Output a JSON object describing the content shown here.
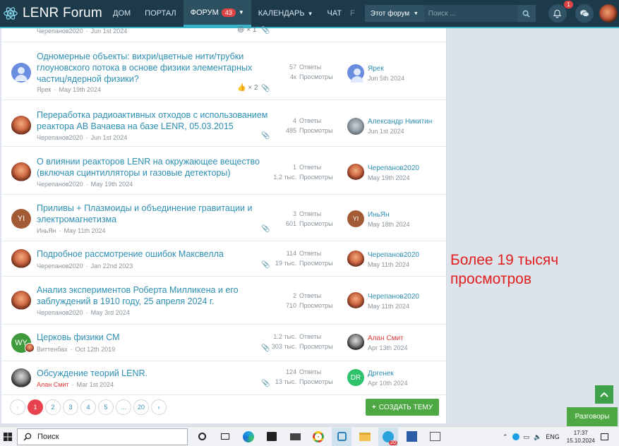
{
  "header": {
    "logo_text": "LENR Forum",
    "nav": [
      {
        "label": "ДОМ"
      },
      {
        "label": "ПОРТАЛ"
      },
      {
        "label": "ФОРУМ",
        "badge": "43",
        "active": true
      },
      {
        "label": "КАЛЕНДАРЬ"
      },
      {
        "label": "ЧАТ"
      }
    ],
    "nav_overflow": "F",
    "search_scope": "Этот форум",
    "search_placeholder": "Поиск ...",
    "alerts_badge": "1"
  },
  "threads": [
    {
      "title": "",
      "author": "Черепанов2020",
      "date": "Jun 1st 2024",
      "likes": "× 1",
      "partial": true
    },
    {
      "title": "Одномерные объекты: вихри/цветные нити/трубки глоуновского потока в основе физики элементарных частиц/ядерной физики?",
      "author": "Ярек",
      "date": "May 19th 2024",
      "likes": "× 2",
      "replies": "57",
      "views": "4к",
      "last_user": "Ярек",
      "last_date": "Jun 5th 2024"
    },
    {
      "title": "Переработка радиоактивных отходов с использованием реактора АВ Вачаева на базе LENR, 05.03.2015",
      "author": "Черепанов2020",
      "date": "Jun 1st 2024",
      "replies": "4",
      "views": "485",
      "last_user": "Александр Никитин",
      "last_date": "Jun 1st 2024"
    },
    {
      "title": "О влиянии реакторов LENR на окружающее вещество (включая сцинтилляторы и газовые детекторы)",
      "author": "Черепанов2020",
      "date": "May 19th 2024",
      "replies": "1",
      "views": "1.2 тыс.",
      "last_user": "Черепанов2020",
      "last_date": "May 19th 2024"
    },
    {
      "title": "Приливы + Плазмоиды и объединение гравитации и электромагнетизма",
      "author": "ИньЯн",
      "date": "May 11th 2024",
      "avatar_initials": "YI",
      "replies": "3",
      "views": "601",
      "last_user": "ИньЯн",
      "last_date": "May 18th 2024",
      "last_initials": "YI"
    },
    {
      "title": "Подробное рассмотрение ошибок Максвелла",
      "author": "Черепанов2020",
      "date": "Jan 22nd 2023",
      "replies": "114",
      "views": "19 тыс.",
      "last_user": "Черепанов2020",
      "last_date": "May 11th 2024"
    },
    {
      "title": "Анализ экспериментов Роберта Милликена и его заблуждений в 1910 году, 25 апреля 2024 г.",
      "author": "Черепанов2020",
      "date": "May 3rd 2024",
      "replies": "2",
      "views": "710",
      "last_user": "Черепанов2020",
      "last_date": "May 11th 2024"
    },
    {
      "title": "Церковь физики СМ",
      "author": "Виттенбах",
      "date": "Oct 12th 2019",
      "avatar_initials": "WY",
      "replies": "1.2 тыс.",
      "views": "303 тыс.",
      "last_user": "Алан Смит",
      "last_date": "Apr 13th 2024"
    },
    {
      "title": "Обсуждение теорий LENR.",
      "author": "Алан Смит",
      "date": "Mar 1st 2024",
      "replies": "124",
      "views": "13 тыс.",
      "last_user": "Дргенек",
      "last_date": "Apr 10th 2024",
      "last_initials": "DR"
    }
  ],
  "labels": {
    "replies": "Ответы",
    "views": "Просмотры"
  },
  "pagination": {
    "pages": [
      "1",
      "2",
      "3",
      "4",
      "5",
      "…",
      "20"
    ],
    "current": "1"
  },
  "create_button": "СОЗДАТЬ ТЕМУ",
  "annotation": {
    "line1": "Более 19 тысяч",
    "line2": "просмотров"
  },
  "conversations_button": "Разговоры",
  "taskbar": {
    "search_label": "Поиск",
    "lang": "ENG",
    "time": "17:37",
    "date": "15.10.2024",
    "telegram_badge": "20"
  },
  "colors": {
    "header_bg": "#1d3a4a",
    "link": "#2d8fb3",
    "accent_green": "#4ea843",
    "annotation_red": "#e02020"
  }
}
